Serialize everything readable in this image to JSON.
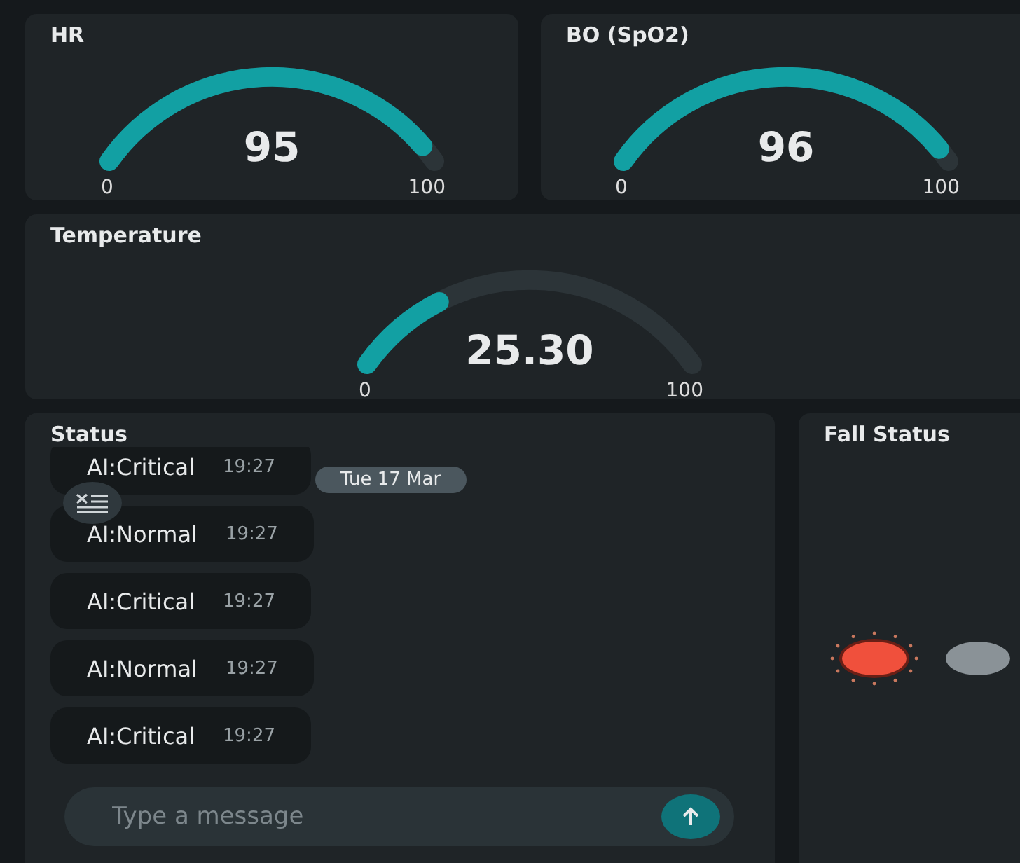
{
  "gauges": [
    {
      "title": "HR",
      "value": "95",
      "min": "0",
      "max": "100"
    },
    {
      "title": "BO (SpO2)",
      "value": "96",
      "min": "0",
      "max": "100"
    },
    {
      "title": "Temperature",
      "value": "25.30",
      "min": "0",
      "max": "100"
    }
  ],
  "status": {
    "title": "Status",
    "date": "Tue 17 Mar",
    "messages": [
      {
        "text": "AI:Critical",
        "time": "19:27"
      },
      {
        "text": "AI:Normal",
        "time": "19:27"
      },
      {
        "text": "AI:Critical",
        "time": "19:27"
      },
      {
        "text": "AI:Normal",
        "time": "19:27"
      },
      {
        "text": "AI:Critical",
        "time": "19:27"
      }
    ],
    "input": {
      "placeholder": "Type a message"
    }
  },
  "fall_status": {
    "title": "Fall Status",
    "lamps": [
      {
        "on": true,
        "color": "#f0503c"
      },
      {
        "on": false,
        "color": "#8a9297"
      }
    ]
  }
}
